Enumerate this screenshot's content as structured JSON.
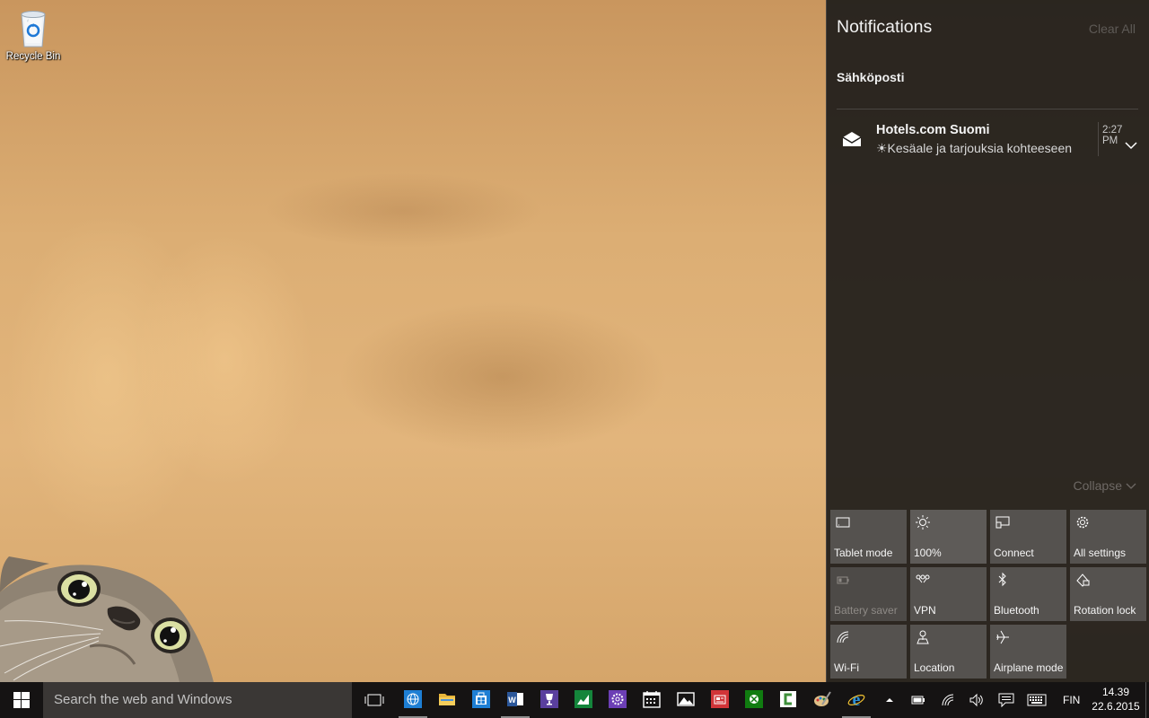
{
  "desktop": {
    "icons": [
      {
        "label": "Recycle Bin",
        "icon": "recycle-bin-icon"
      }
    ],
    "wallpaper_color": "#d9ab72"
  },
  "action_center": {
    "title": "Notifications",
    "clear_all": "Clear All",
    "groups": [
      {
        "app": "Sähköposti",
        "notifications": [
          {
            "title": "Hotels.com Suomi",
            "body": "☀Kesäale ja tarjouksia kohteeseen",
            "time": "2:27 PM",
            "icon": "mail-icon"
          }
        ]
      }
    ],
    "collapse_label": "Collapse",
    "quick_actions": [
      {
        "label": "Tablet mode",
        "icon": "tablet-mode-icon",
        "state": "off"
      },
      {
        "label": "100%",
        "icon": "brightness-icon",
        "state": "on"
      },
      {
        "label": "Connect",
        "icon": "connect-icon",
        "state": "off"
      },
      {
        "label": "All settings",
        "icon": "settings-gear-icon",
        "state": "off"
      },
      {
        "label": "Battery saver",
        "icon": "battery-saver-icon",
        "state": "disabled"
      },
      {
        "label": "VPN",
        "icon": "vpn-icon",
        "state": "off"
      },
      {
        "label": "Bluetooth",
        "icon": "bluetooth-icon",
        "state": "off"
      },
      {
        "label": "Rotation lock",
        "icon": "rotation-lock-icon",
        "state": "off"
      },
      {
        "label": "Wi-Fi",
        "icon": "wifi-icon",
        "state": "off"
      },
      {
        "label": "Location",
        "icon": "location-icon",
        "state": "off"
      },
      {
        "label": "Airplane mode",
        "icon": "airplane-icon",
        "state": "off"
      }
    ]
  },
  "taskbar": {
    "search_placeholder": "Search the web and Windows",
    "pinned_apps": [
      {
        "name": "globe-app-icon",
        "color": "#1e7fd4",
        "running": true
      },
      {
        "name": "file-explorer-icon",
        "color": "#e8b63a",
        "running": false
      },
      {
        "name": "store-icon",
        "color": "#1e7fd4",
        "running": false
      },
      {
        "name": "word-icon",
        "color": "#2b579a",
        "running": true
      },
      {
        "name": "trophy-app-icon",
        "color": "#5a3f9e",
        "running": false
      },
      {
        "name": "money-app-icon",
        "color": "#14853b",
        "running": false
      },
      {
        "name": "settings-app-icon",
        "color": "#6c3fb5",
        "running": false
      },
      {
        "name": "calendar-icon",
        "color": "#ffffff",
        "running": false
      },
      {
        "name": "photos-icon",
        "color": "#ffffff",
        "running": false
      },
      {
        "name": "news-app-icon",
        "color": "#d13438",
        "running": false
      },
      {
        "name": "xbox-icon",
        "color": "#107c10",
        "running": false
      },
      {
        "name": "camtasia-icon",
        "color": "#3e8e3a",
        "running": false
      },
      {
        "name": "paint-icon",
        "color": "#d8a041",
        "running": false
      },
      {
        "name": "internet-explorer-icon",
        "color": "#2a8fd8",
        "running": true
      }
    ],
    "tray": {
      "language": "FIN",
      "time": "14.39",
      "date": "22.6.2015"
    }
  }
}
